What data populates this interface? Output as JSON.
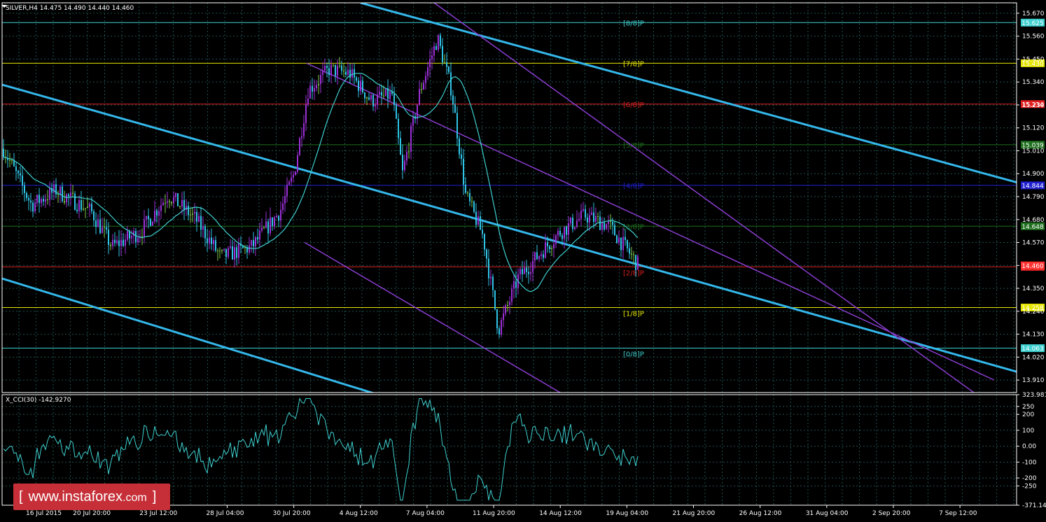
{
  "header": {
    "symbol_text": "SILVER,H4",
    "ohlc_text": "14.475 14.490 14.440 14.460"
  },
  "watermark": {
    "open": "[",
    "site": "www.instaforex",
    "tld": ".com",
    "close": "]"
  },
  "colors": {
    "bg": "#000000",
    "bull": "#9b2fd6",
    "bear": "#2fc3e6",
    "doji": "#7ec94a",
    "ma": "#3fd0d0",
    "channel_blue": "#34b7ea",
    "channel_purple": "#8a3dd0",
    "grid": "#1f4f4f"
  },
  "chart_data": [
    {
      "type": "candlestick",
      "title": "SILVER,H4",
      "ylim": [
        13.85,
        15.72
      ],
      "y_ticks": [
        "15.670",
        "15.560",
        "15.450",
        "15.340",
        "15.230",
        "15.120",
        "15.010",
        "14.900",
        "14.790",
        "14.680",
        "14.570",
        "14.460",
        "14.350",
        "14.240",
        "14.130",
        "14.020",
        "13.910"
      ],
      "x_ticks": [
        "16 Jul 2015",
        "20 Jul 20:00",
        "23 Jul 12:00",
        "28 Jul 04:00",
        "30 Jul 20:00",
        "4 Aug 12:00",
        "7 Aug 04:00",
        "11 Aug 20:00",
        "14 Aug 12:00",
        "19 Aug 04:00",
        "21 Aug 20:00",
        "26 Aug 12:00",
        "31 Aug 04:00",
        "2 Sep 20:00",
        "7 Sep 12:00"
      ],
      "last_price": {
        "label": "14.460",
        "value": 14.46,
        "color": "#ff3030"
      },
      "murrey_levels": [
        {
          "label": "[8/8]P",
          "value": 15.625,
          "price_label": "15.625",
          "color": "#3fd0d0",
          "box_bg": "#3fd0d0",
          "box_fg": "#000000"
        },
        {
          "label": "[7/8]P",
          "value": 15.43,
          "price_label": "15.430",
          "color": "#e6e600",
          "box_bg": "#e6e600",
          "box_fg": "#000000"
        },
        {
          "label": "[6/8]P",
          "value": 15.234,
          "price_label": "15.234",
          "color": "#e02020",
          "box_bg": "#e02020",
          "box_fg": "#000000"
        },
        {
          "label": "[5/8]P",
          "value": 15.039,
          "price_label": "15.039",
          "color": "#1f6f1f",
          "box_bg": "#1f6f1f",
          "box_fg": "#000000"
        },
        {
          "label": "[4/8]P",
          "value": 14.844,
          "price_label": "14.844",
          "color": "#2020d0",
          "box_bg": "#2020d0",
          "box_fg": "#000000"
        },
        {
          "label": "[3/8]P",
          "value": 14.648,
          "price_label": "14.648",
          "color": "#1f6f1f",
          "box_bg": "#1f6f1f",
          "box_fg": "#000000"
        },
        {
          "label": "[2/8]P",
          "value": 14.453,
          "price_label": "14.453",
          "color": "#e02020",
          "box_bg": "#e02020",
          "box_fg": "#000000"
        },
        {
          "label": "[1/8]P",
          "value": 14.258,
          "price_label": "14.258",
          "color": "#e6e600",
          "box_bg": "#e6e600",
          "box_fg": "#000000"
        },
        {
          "label": "[0/8]P",
          "value": 14.063,
          "price_label": "14.063",
          "color": "#3fd0d0",
          "box_bg": "#3fd0d0",
          "box_fg": "#000000"
        }
      ],
      "trend_lines": [
        {
          "color": "#34b7ea",
          "width": 3,
          "from": [
            0,
            15.33
          ],
          "to": [
            1494,
            13.91
          ]
        },
        {
          "color": "#34b7ea",
          "width": 3,
          "from": [
            0,
            14.4
          ],
          "to": [
            540,
            13.84
          ]
        },
        {
          "color": "#34b7ea",
          "width": 3,
          "from": [
            515,
            15.72
          ],
          "to": [
            1494,
            14.82
          ]
        },
        {
          "color": "#8a3dd0",
          "width": 1.5,
          "from": [
            438,
            15.43
          ],
          "to": [
            1420,
            13.91
          ]
        },
        {
          "color": "#8a3dd0",
          "width": 1.5,
          "from": [
            435,
            14.57
          ],
          "to": [
            800,
            13.85
          ]
        },
        {
          "color": "#8a3dd0",
          "width": 1.5,
          "from": [
            620,
            15.72
          ],
          "to": [
            1494,
            13.6
          ]
        }
      ]
    },
    {
      "type": "line",
      "title": "X_CCI(30) -142.9270",
      "ylim": [
        -371.141,
        323.981
      ],
      "y_ticks": [
        "323.9814",
        "250",
        "200",
        "100",
        "0.00",
        "-100",
        "-200",
        "-250",
        "-371.141"
      ]
    }
  ]
}
